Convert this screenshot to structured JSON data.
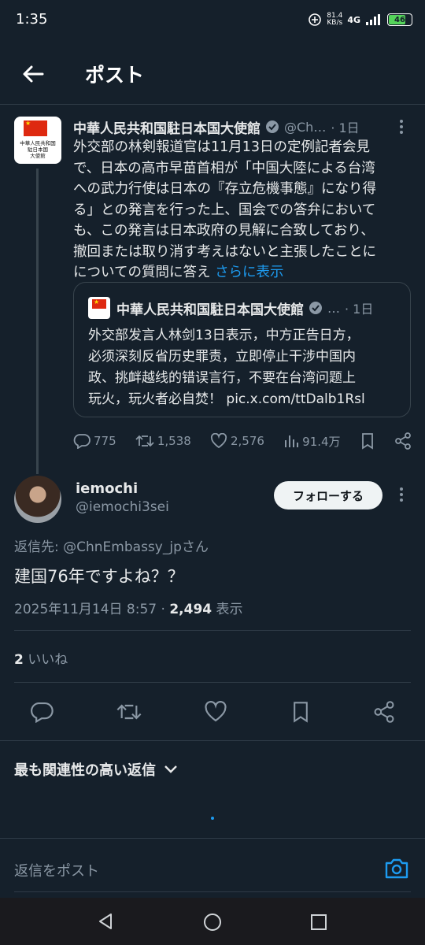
{
  "status_bar": {
    "time": "1:35",
    "net_speed_value": "81.4",
    "net_speed_unit": "KB/s",
    "network": "4G",
    "battery": "46"
  },
  "header": {
    "title": "ポスト"
  },
  "parent_tweet": {
    "avatar_text": [
      "中華人民共和国",
      "駐日本国",
      "大使館"
    ],
    "author_name": "中華人民共和国駐日本国大使館",
    "handle": "@Ch…",
    "time": "· 1日",
    "body_lines": [
      "外交部の林剣報道官は11月13日の定例記者会見",
      "で、日本の高市早苗首相が「中国大陸による台湾",
      "への武力行使は日本の『存立危機事態』になり得",
      "る」との発言を行った上、国会での答弁において",
      "も、この発言は日本政府の見解に合致しており、",
      "撤回または取り消す考えはないと主張したことに"
    ],
    "body_last_line": "についての質問に答え",
    "show_more": "さらに表示",
    "quote": {
      "author_name": "中華人民共和国駐日本国大使館",
      "handle": "…",
      "time": "· 1日",
      "body_lines": [
        "外交部发言人林剑13日表示，中方正告日方，",
        "必须深刻反省历史罪责，立即停止干涉中国内",
        "政、挑衅越线的错误言行，不要在台湾问题上",
        "玩火，玩火者必自焚！ pic.x.com/ttDalb1Rsl"
      ]
    },
    "actions": {
      "replies": "775",
      "reposts": "1,538",
      "likes": "2,576",
      "views": "91.4万"
    }
  },
  "main_tweet": {
    "author_name": "iemochi",
    "handle": "@iemochi3sei",
    "follow_label": "フォローする",
    "reply_to_prefix": "返信先: ",
    "reply_to_handle": "@ChnEmbassy_jp",
    "reply_to_suffix": "さん",
    "text": "建国76年ですよね？？",
    "timestamp": "2025年11月14日 8:57 · ",
    "view_count": "2,494",
    "view_label": " 表示",
    "like_count": "2",
    "like_label": " いいね"
  },
  "replies_sort": {
    "label": "最も関連性の高い返信"
  },
  "reply_box": {
    "placeholder": "返信をポスト"
  },
  "colors": {
    "background": "#15202b",
    "accent": "#1d9bf0",
    "muted": "#8b98a5"
  }
}
